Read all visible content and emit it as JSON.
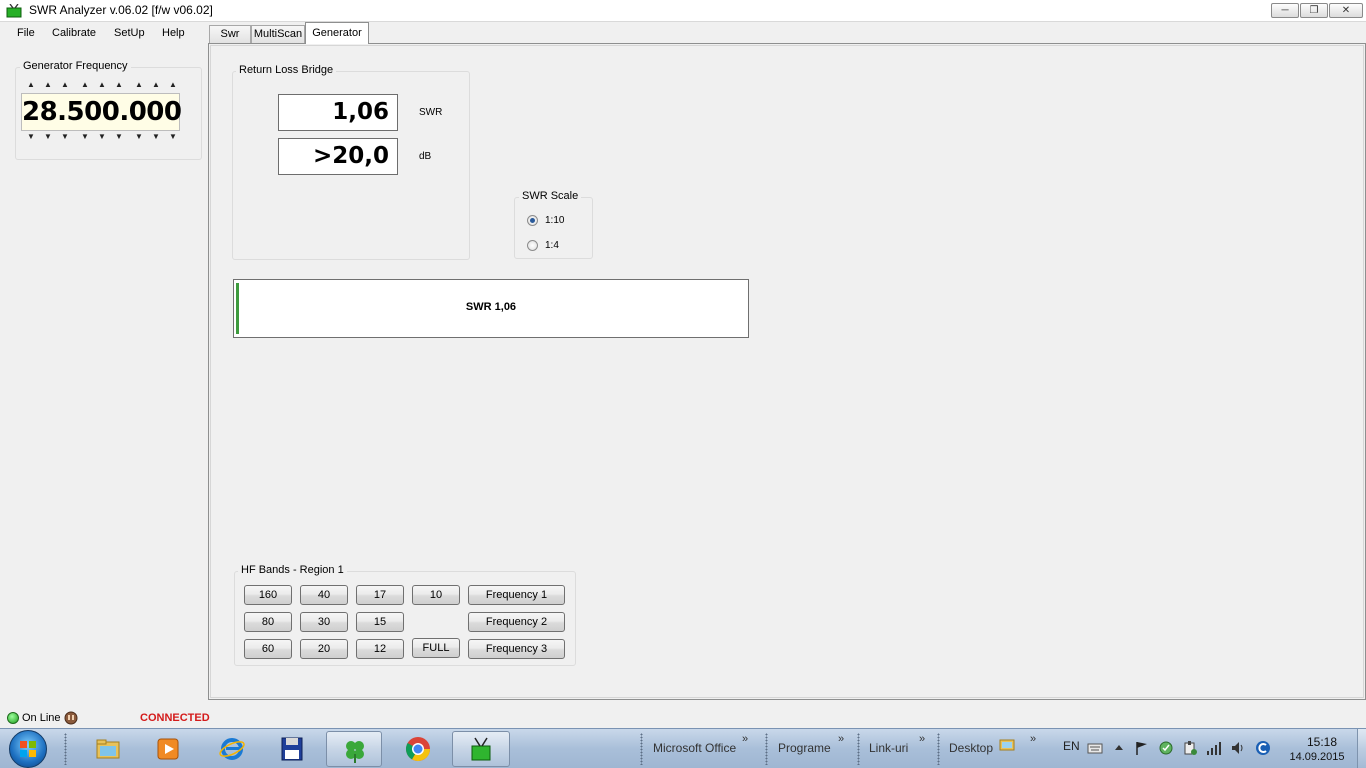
{
  "window": {
    "title": "SWR Analyzer v.06.02 [f/w v06.02]"
  },
  "menu": {
    "items": [
      "File",
      "Calibrate",
      "SetUp",
      "Help"
    ]
  },
  "tabs": [
    {
      "label": "Swr"
    },
    {
      "label": "MultiScan"
    },
    {
      "label": "Generator",
      "active": true
    }
  ],
  "generator": {
    "title": "Generator Frequency",
    "frequency": "28.500.000"
  },
  "return_loss_bridge": {
    "title": "Return Loss Bridge",
    "swr_value": "1,06",
    "swr_unit": "SWR",
    "db_value": ">20,0",
    "db_unit": "dB"
  },
  "swr_scale": {
    "title": "SWR Scale",
    "options": [
      {
        "label": "1:10",
        "checked": true
      },
      {
        "label": "1:4",
        "checked": false
      }
    ]
  },
  "swr_bar": {
    "label": "SWR 1,06",
    "fill_color": "#3e9b3e"
  },
  "hf_bands": {
    "title": "HF Bands - Region 1",
    "rows": [
      [
        "160",
        "40",
        "17",
        "10"
      ],
      [
        "80",
        "30",
        "15"
      ],
      [
        "60",
        "20",
        "12",
        "FULL"
      ]
    ],
    "frequency_buttons": [
      "Frequency 1",
      "Frequency 2",
      "Frequency 3"
    ]
  },
  "status": {
    "online": "On Line",
    "connection": "CONNECTED",
    "connection_color": "#d41a1a",
    "led_color": "#1c9c1c"
  },
  "taskbar": {
    "apps": [
      "folder-icon",
      "media-player-icon",
      "ie-icon",
      "floppy-disk-icon",
      "clover-icon",
      "chrome-icon",
      "swr-analyzer-icon"
    ],
    "toolbars": [
      "Microsoft Office",
      "Programe",
      "Link-uri",
      "Desktop"
    ],
    "language": "EN",
    "time": "15:18",
    "date": "14.09.2015"
  }
}
